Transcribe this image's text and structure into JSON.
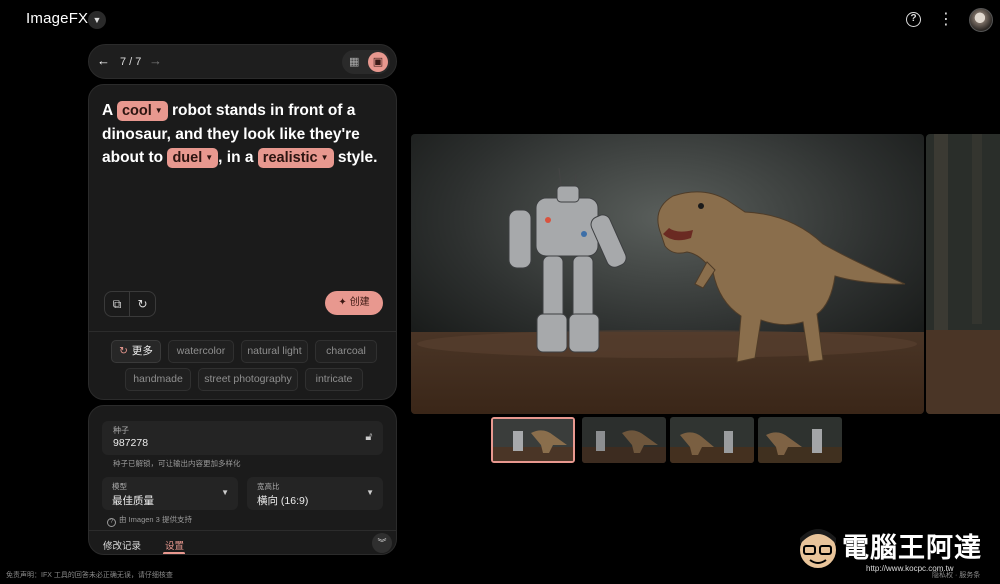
{
  "app": {
    "title": "ImageFX"
  },
  "navigation": {
    "counter": "7 / 7"
  },
  "prompt": {
    "parts": [
      {
        "type": "text",
        "value": "A "
      },
      {
        "type": "chip",
        "value": "cool"
      },
      {
        "type": "text",
        "value": " robot stands in front of a dinosaur, and they look like they're about to "
      },
      {
        "type": "chip",
        "value": "duel"
      },
      {
        "type": "text",
        "value": ", in a "
      },
      {
        "type": "chip",
        "value": "realistic"
      },
      {
        "type": "text",
        "value": " style."
      }
    ]
  },
  "actions": {
    "create_label": "创建"
  },
  "tags": {
    "more_label": "更多",
    "items": [
      "watercolor",
      "natural light",
      "charcoal",
      "handmade",
      "street photography",
      "intricate"
    ]
  },
  "settings": {
    "seed_label": "种子",
    "seed_value": "987278",
    "seed_hint": "种子已解锁，可让输出内容更加多样化",
    "model_label": "模型",
    "model_value": "最佳质量",
    "ratio_label": "宽高比",
    "ratio_value": "横向 (16:9)",
    "model_note": "由 Imagen 3 提供支持"
  },
  "bottom_tabs": {
    "history": "修改记录",
    "settings": "设置"
  },
  "footer": {
    "note": "免责声明：IFX 工具的回答未必正确无误，请仔细核查",
    "links": "隐私权 · 服务条"
  },
  "watermark": {
    "text": "電腦王阿達",
    "url": "http://www.kocpc.com.tw"
  },
  "colors": {
    "accent": "#e8988f",
    "panel": "#1b1b1b",
    "background": "#000000"
  }
}
